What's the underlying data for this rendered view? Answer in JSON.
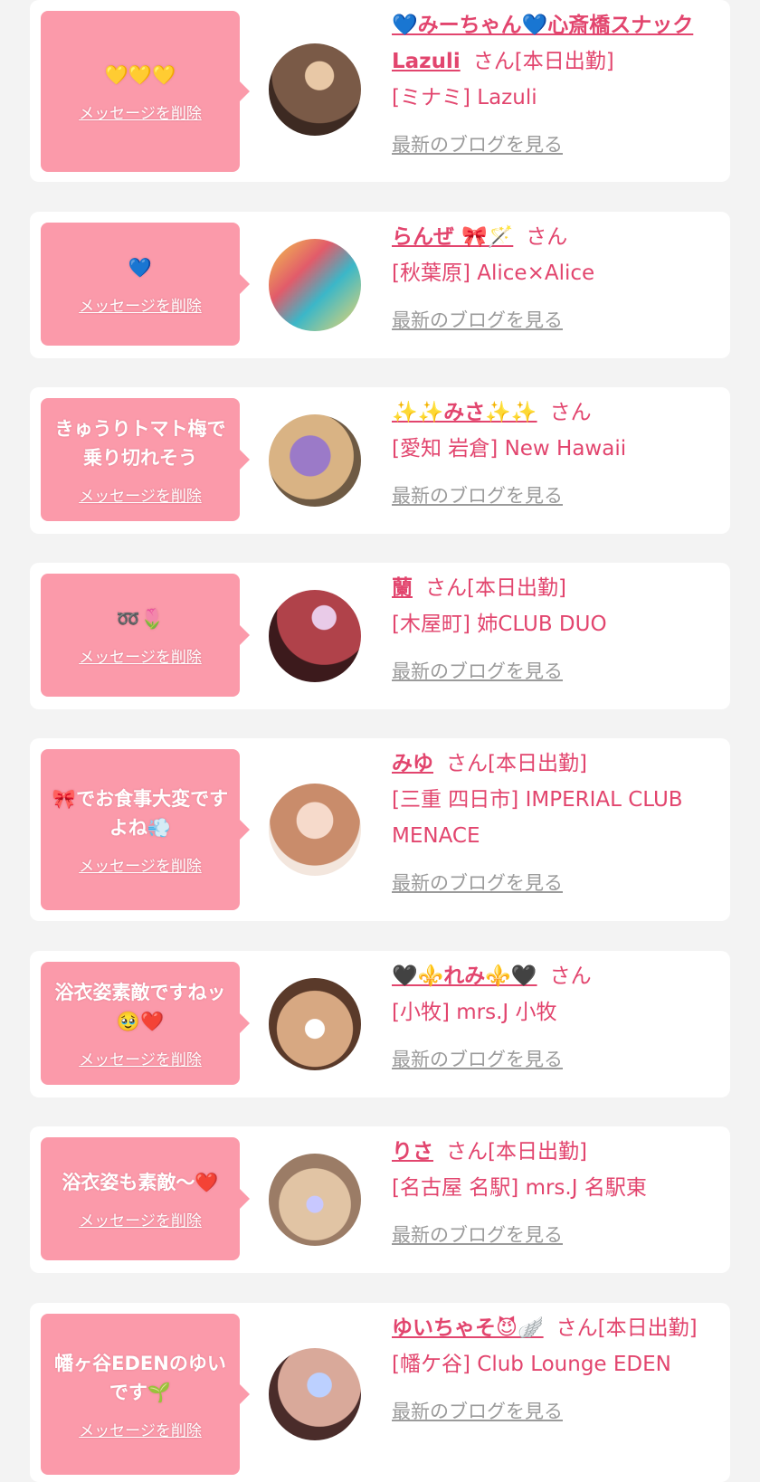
{
  "delete_label": "メッセージを削除",
  "blog_label": "最新のブログを見る",
  "honorific": "さん",
  "colors": {
    "page_bg": "#f3f3f3",
    "card_bg": "#ffffff",
    "bubble": "#fb9aaa",
    "accent": "#e2456e",
    "link_grey": "#9b9b9b"
  },
  "messages": [
    {
      "message": "💛💛💛",
      "cast_name": "💙みーちゃん💙心斎橋スナックLazuli",
      "status": "[本日出勤]",
      "shop": "[ミナミ] Lazuli"
    },
    {
      "message": "💙",
      "cast_name": "らんぜ 🎀🪄",
      "status": "",
      "shop": "[秋葉原] Alice×Alice"
    },
    {
      "message": "きゅうりトマト梅で乗り切れそう",
      "cast_name": "✨✨みさ✨✨",
      "status": "",
      "shop": "[愛知 岩倉] New Hawaii"
    },
    {
      "message": "➿🌷",
      "cast_name": "蘭",
      "status": "[本日出勤]",
      "shop": "[木屋町] 姉CLUB DUO"
    },
    {
      "message": "🎀でお食事大変ですよね💨",
      "cast_name": "みゆ",
      "status": "[本日出勤]",
      "shop": "[三重 四日市] IMPERIAL CLUB MENACE"
    },
    {
      "message": "浴衣姿素敵ですねッ🥹❤️",
      "cast_name": "🖤⚜️れみ⚜️🖤",
      "status": "",
      "shop": "[小牧] mrs.J 小牧"
    },
    {
      "message": "浴衣姿も素敵〜❤️",
      "cast_name": "りさ",
      "status": "[本日出勤]",
      "shop": "[名古屋 名駅] mrs.J 名駅東"
    },
    {
      "message": "幡ヶ谷EDENのゆいです🌱",
      "cast_name": "ゆいちゃそ😈🪽",
      "status": "[本日出勤]",
      "shop": "[幡ケ谷] Club Lounge EDEN"
    }
  ]
}
